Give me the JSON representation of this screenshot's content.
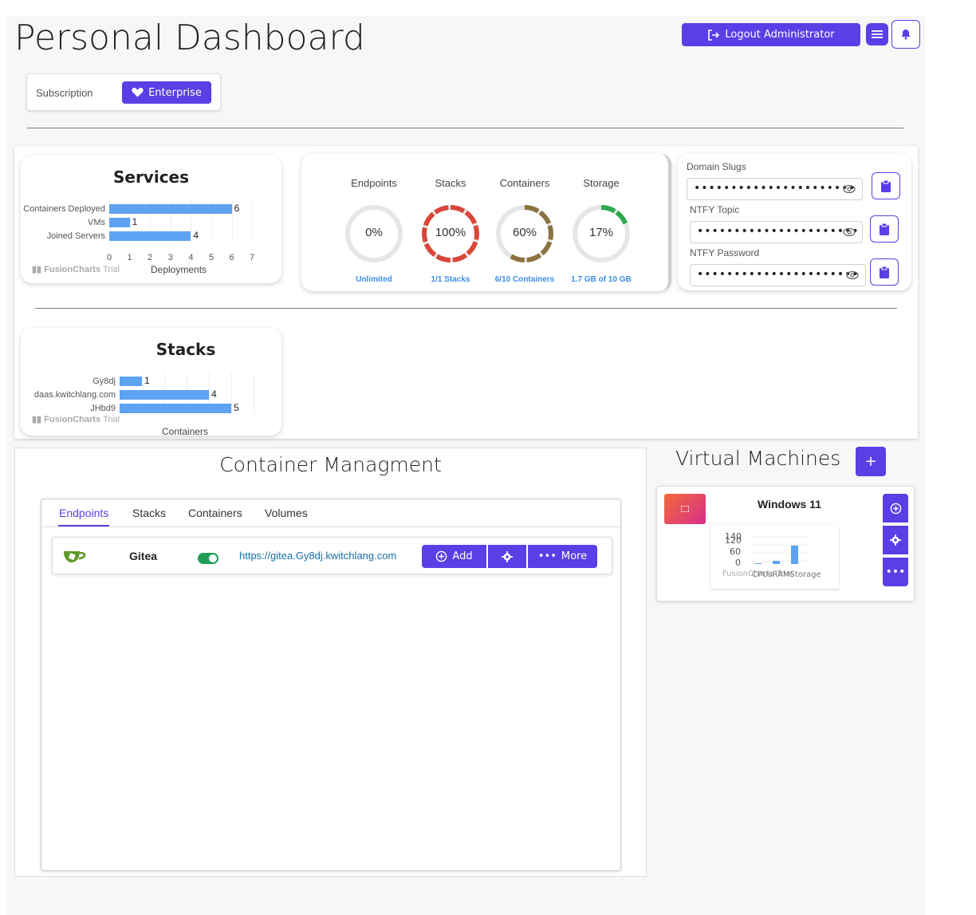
{
  "header": {
    "title": "Personal Dashboard",
    "logout_label": "Logout Administrator"
  },
  "subscription": {
    "label": "Subscription",
    "plan": "Enterprise"
  },
  "services_chart": {
    "title": "Services",
    "xlabel": "Deployments",
    "categories": [
      "Containers Deployed",
      "VMs",
      "Joined Servers"
    ],
    "values": [
      6,
      1,
      4
    ],
    "ticks": [
      "0",
      "1",
      "2",
      "3",
      "4",
      "5",
      "6",
      "7"
    ],
    "brand": "FusionCharts",
    "brand_trial": "Trial"
  },
  "stacks_chart": {
    "title": "Stacks",
    "xlabel": "Containers",
    "categories": [
      "Gy8dj",
      "daas.kwitchlang.com",
      "JHbd9"
    ],
    "values": [
      1,
      4,
      5
    ],
    "brand": "FusionCharts",
    "brand_trial": "Trial"
  },
  "chart_data": [
    {
      "type": "bar",
      "title": "Services",
      "xlabel": "Deployments",
      "categories": [
        "Containers Deployed",
        "VMs",
        "Joined Servers"
      ],
      "values": [
        6,
        1,
        4
      ],
      "xlim": [
        0,
        7
      ]
    },
    {
      "type": "bar",
      "title": "Stacks",
      "xlabel": "Containers",
      "categories": [
        "Gy8dj",
        "daas.kwitchlang.com",
        "JHbd9"
      ],
      "values": [
        1,
        4,
        5
      ]
    },
    {
      "type": "bar",
      "title": "",
      "categories": [
        "CPUs",
        "RAM",
        "Storage"
      ],
      "values": [
        2,
        15,
        80
      ],
      "y_ticks": [
        "0",
        "60",
        "120",
        "140"
      ],
      "ylim": [
        0,
        140
      ]
    }
  ],
  "gauges": [
    {
      "label": "Endpoints",
      "pct_text": "0%",
      "pct": 0,
      "sub": "Unlimited",
      "color": "#e0e0e0"
    },
    {
      "label": "Stacks",
      "pct_text": "100%",
      "pct": 100,
      "sub": "1/1 Stacks",
      "color": "#d9473a"
    },
    {
      "label": "Containers",
      "pct_text": "60%",
      "pct": 60,
      "sub": "6/10 Containers",
      "color": "#8a7340"
    },
    {
      "label": "Storage",
      "pct_text": "17%",
      "pct": 17,
      "sub": "1.7 GB of 10 GB",
      "color": "#2ea84f"
    }
  ],
  "secrets": {
    "domain_label": "Domain Slugs",
    "domain_value": "••••••••••••••••••••••",
    "ntfy_topic_label": "NTFY Topic",
    "ntfy_topic_value": "••••••••••••••••••••••",
    "ntfy_password_label": "NTFY Password",
    "ntfy_password_value": "••••••••••••••••••••••"
  },
  "container_mgmt": {
    "title": "Container Managment",
    "tabs": [
      "Endpoints",
      "Stacks",
      "Containers",
      "Volumes"
    ],
    "endpoint": {
      "name": "Gitea",
      "url": "https://gitea.Gy8dj.kwitchlang.com",
      "add_label": "Add",
      "more_label": "More"
    }
  },
  "vms": {
    "title": "Virtual Machines",
    "add_label": "+",
    "item": {
      "name": "Windows 11",
      "y_ticks": [
        "140",
        "120",
        "60",
        "0"
      ],
      "x_labels": "CPUsRAMStorage",
      "brand": "FusionCharts Trial"
    }
  },
  "colors": {
    "accent": "#5b3ee6",
    "bar": "#5ea2f2",
    "link": "#1a6fa8",
    "toggle": "#1f9d55"
  }
}
